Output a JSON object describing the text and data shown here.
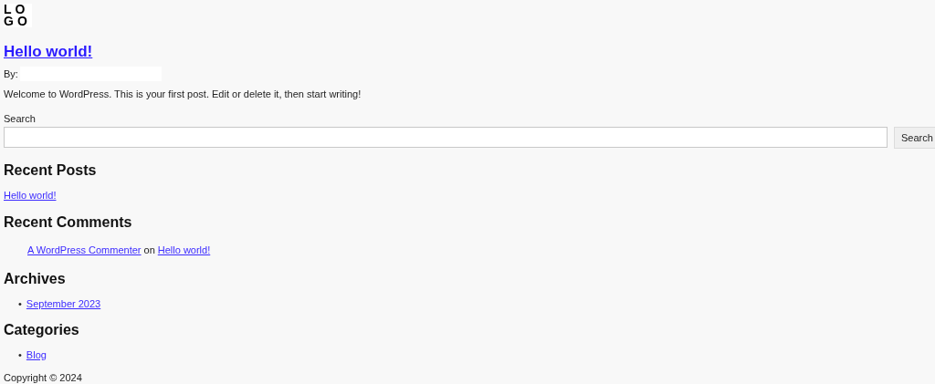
{
  "logo": {
    "rows": [
      "LO",
      "GO"
    ]
  },
  "post": {
    "title": "Hello world!",
    "byline": "By:",
    "excerpt": "Welcome to WordPress. This is your first post. Edit or delete it, then start writing!"
  },
  "search": {
    "label": "Search",
    "button": "Search"
  },
  "recent_posts": {
    "heading": "Recent Posts",
    "items": [
      "Hello world!"
    ]
  },
  "recent_comments": {
    "heading": "Recent Comments",
    "items": [
      {
        "author": "A WordPress Commenter",
        "joiner": "on",
        "post": "Hello world!"
      }
    ]
  },
  "archives": {
    "heading": "Archives",
    "bullet": "•",
    "items": [
      "September 2023"
    ]
  },
  "categories": {
    "heading": "Categories",
    "bullet": "•",
    "items": [
      "Blog"
    ]
  },
  "footer": {
    "copyright": "Copyright © 2024"
  }
}
